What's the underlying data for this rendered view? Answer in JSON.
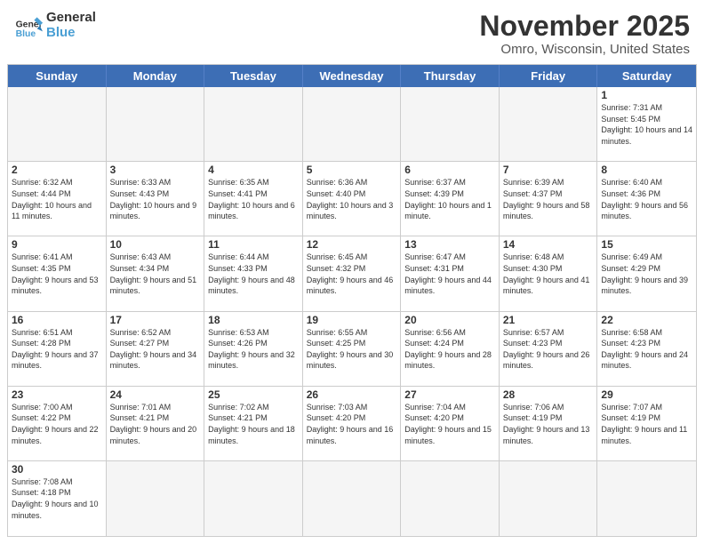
{
  "header": {
    "logo_general": "General",
    "logo_blue": "Blue",
    "month_title": "November 2025",
    "location": "Omro, Wisconsin, United States"
  },
  "days": [
    "Sunday",
    "Monday",
    "Tuesday",
    "Wednesday",
    "Thursday",
    "Friday",
    "Saturday"
  ],
  "weeks": [
    [
      {
        "num": "",
        "info": "",
        "empty": true
      },
      {
        "num": "",
        "info": "",
        "empty": true
      },
      {
        "num": "",
        "info": "",
        "empty": true
      },
      {
        "num": "",
        "info": "",
        "empty": true
      },
      {
        "num": "",
        "info": "",
        "empty": true
      },
      {
        "num": "",
        "info": "",
        "empty": true
      },
      {
        "num": "1",
        "info": "Sunrise: 7:31 AM\nSunset: 5:45 PM\nDaylight: 10 hours and 14 minutes.",
        "empty": false
      }
    ],
    [
      {
        "num": "2",
        "info": "Sunrise: 6:32 AM\nSunset: 4:44 PM\nDaylight: 10 hours and 11 minutes.",
        "empty": false
      },
      {
        "num": "3",
        "info": "Sunrise: 6:33 AM\nSunset: 4:43 PM\nDaylight: 10 hours and 9 minutes.",
        "empty": false
      },
      {
        "num": "4",
        "info": "Sunrise: 6:35 AM\nSunset: 4:41 PM\nDaylight: 10 hours and 6 minutes.",
        "empty": false
      },
      {
        "num": "5",
        "info": "Sunrise: 6:36 AM\nSunset: 4:40 PM\nDaylight: 10 hours and 3 minutes.",
        "empty": false
      },
      {
        "num": "6",
        "info": "Sunrise: 6:37 AM\nSunset: 4:39 PM\nDaylight: 10 hours and 1 minute.",
        "empty": false
      },
      {
        "num": "7",
        "info": "Sunrise: 6:39 AM\nSunset: 4:37 PM\nDaylight: 9 hours and 58 minutes.",
        "empty": false
      },
      {
        "num": "8",
        "info": "Sunrise: 6:40 AM\nSunset: 4:36 PM\nDaylight: 9 hours and 56 minutes.",
        "empty": false
      }
    ],
    [
      {
        "num": "9",
        "info": "Sunrise: 6:41 AM\nSunset: 4:35 PM\nDaylight: 9 hours and 53 minutes.",
        "empty": false
      },
      {
        "num": "10",
        "info": "Sunrise: 6:43 AM\nSunset: 4:34 PM\nDaylight: 9 hours and 51 minutes.",
        "empty": false
      },
      {
        "num": "11",
        "info": "Sunrise: 6:44 AM\nSunset: 4:33 PM\nDaylight: 9 hours and 48 minutes.",
        "empty": false
      },
      {
        "num": "12",
        "info": "Sunrise: 6:45 AM\nSunset: 4:32 PM\nDaylight: 9 hours and 46 minutes.",
        "empty": false
      },
      {
        "num": "13",
        "info": "Sunrise: 6:47 AM\nSunset: 4:31 PM\nDaylight: 9 hours and 44 minutes.",
        "empty": false
      },
      {
        "num": "14",
        "info": "Sunrise: 6:48 AM\nSunset: 4:30 PM\nDaylight: 9 hours and 41 minutes.",
        "empty": false
      },
      {
        "num": "15",
        "info": "Sunrise: 6:49 AM\nSunset: 4:29 PM\nDaylight: 9 hours and 39 minutes.",
        "empty": false
      }
    ],
    [
      {
        "num": "16",
        "info": "Sunrise: 6:51 AM\nSunset: 4:28 PM\nDaylight: 9 hours and 37 minutes.",
        "empty": false
      },
      {
        "num": "17",
        "info": "Sunrise: 6:52 AM\nSunset: 4:27 PM\nDaylight: 9 hours and 34 minutes.",
        "empty": false
      },
      {
        "num": "18",
        "info": "Sunrise: 6:53 AM\nSunset: 4:26 PM\nDaylight: 9 hours and 32 minutes.",
        "empty": false
      },
      {
        "num": "19",
        "info": "Sunrise: 6:55 AM\nSunset: 4:25 PM\nDaylight: 9 hours and 30 minutes.",
        "empty": false
      },
      {
        "num": "20",
        "info": "Sunrise: 6:56 AM\nSunset: 4:24 PM\nDaylight: 9 hours and 28 minutes.",
        "empty": false
      },
      {
        "num": "21",
        "info": "Sunrise: 6:57 AM\nSunset: 4:23 PM\nDaylight: 9 hours and 26 minutes.",
        "empty": false
      },
      {
        "num": "22",
        "info": "Sunrise: 6:58 AM\nSunset: 4:23 PM\nDaylight: 9 hours and 24 minutes.",
        "empty": false
      }
    ],
    [
      {
        "num": "23",
        "info": "Sunrise: 7:00 AM\nSunset: 4:22 PM\nDaylight: 9 hours and 22 minutes.",
        "empty": false
      },
      {
        "num": "24",
        "info": "Sunrise: 7:01 AM\nSunset: 4:21 PM\nDaylight: 9 hours and 20 minutes.",
        "empty": false
      },
      {
        "num": "25",
        "info": "Sunrise: 7:02 AM\nSunset: 4:21 PM\nDaylight: 9 hours and 18 minutes.",
        "empty": false
      },
      {
        "num": "26",
        "info": "Sunrise: 7:03 AM\nSunset: 4:20 PM\nDaylight: 9 hours and 16 minutes.",
        "empty": false
      },
      {
        "num": "27",
        "info": "Sunrise: 7:04 AM\nSunset: 4:20 PM\nDaylight: 9 hours and 15 minutes.",
        "empty": false
      },
      {
        "num": "28",
        "info": "Sunrise: 7:06 AM\nSunset: 4:19 PM\nDaylight: 9 hours and 13 minutes.",
        "empty": false
      },
      {
        "num": "29",
        "info": "Sunrise: 7:07 AM\nSunset: 4:19 PM\nDaylight: 9 hours and 11 minutes.",
        "empty": false
      }
    ],
    [
      {
        "num": "30",
        "info": "Sunrise: 7:08 AM\nSunset: 4:18 PM\nDaylight: 9 hours and 10 minutes.",
        "empty": false
      },
      {
        "num": "",
        "info": "",
        "empty": true
      },
      {
        "num": "",
        "info": "",
        "empty": true
      },
      {
        "num": "",
        "info": "",
        "empty": true
      },
      {
        "num": "",
        "info": "",
        "empty": true
      },
      {
        "num": "",
        "info": "",
        "empty": true
      },
      {
        "num": "",
        "info": "",
        "empty": true
      }
    ]
  ]
}
